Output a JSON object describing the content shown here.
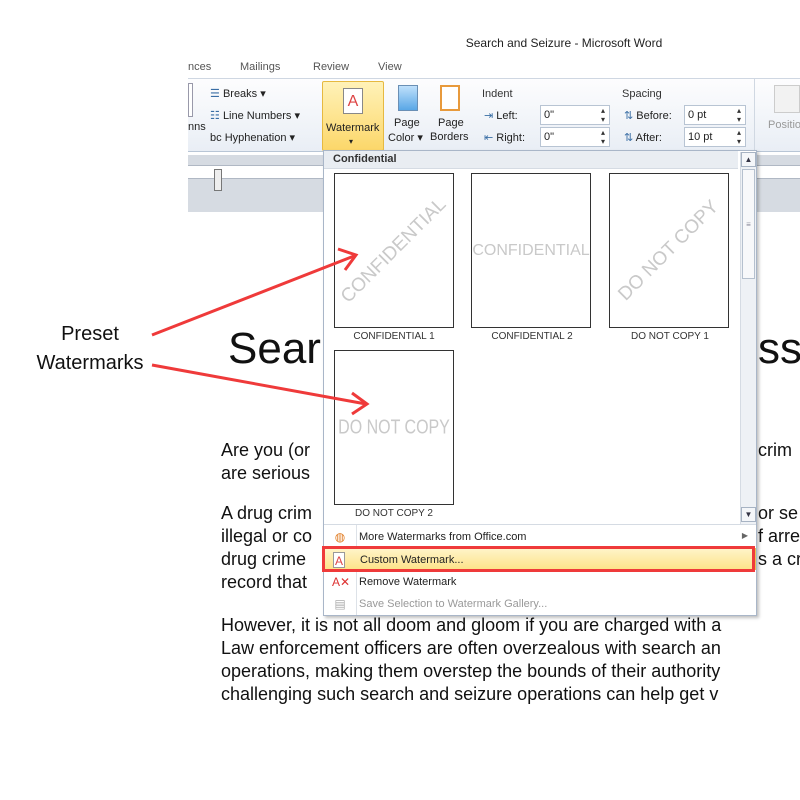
{
  "window": {
    "title": "Search and Seizure  -  Microsoft Word"
  },
  "tabs": [
    "nces",
    "Mailings",
    "Review",
    "View"
  ],
  "ribbon": {
    "page_setup": {
      "breaks": "Breaks",
      "line_numbers": "Line Numbers",
      "hyphenation": "Hyphenation",
      "columns_partial": "nns"
    },
    "watermark": "Watermark",
    "page_color": [
      "Page",
      "Color"
    ],
    "page_borders": [
      "Page",
      "Borders"
    ],
    "indent": {
      "label": "Indent",
      "left_label": "Left:",
      "left_value": "0\"",
      "right_label": "Right:",
      "right_value": "0\""
    },
    "spacing": {
      "label": "Spacing",
      "before_label": "Before:",
      "before_value": "0 pt",
      "after_label": "After:",
      "after_value": "10 pt"
    },
    "position": "Positio"
  },
  "gallery": {
    "header": "Confidential",
    "items": [
      {
        "label": "CONFIDENTIAL 1",
        "text": "CONFIDENTIAL",
        "style": "diagonal"
      },
      {
        "label": "CONFIDENTIAL 2",
        "text": "CONFIDENTIAL",
        "style": "horizontal"
      },
      {
        "label": "DO NOT COPY 1",
        "text": "DO NOT COPY",
        "style": "diagonal"
      },
      {
        "label": "DO NOT COPY 2",
        "text": "DO NOT COPY",
        "style": "horizontal"
      }
    ]
  },
  "menu": [
    {
      "label": "More Watermarks from Office.com",
      "icon": "office-globe-icon",
      "submenu": true
    },
    {
      "label": "Custom Watermark...",
      "icon": "watermark-icon",
      "highlighted": true
    },
    {
      "label": "Remove Watermark",
      "icon": "remove-watermark-icon"
    },
    {
      "label": "Save Selection to Watermark Gallery...",
      "icon": "save-gallery-icon",
      "disabled": true
    }
  ],
  "document": {
    "heading_left": "Sear",
    "heading_right": "ssu",
    "p1": [
      [
        "Are you (or",
        "crim"
      ],
      [
        "are serious",
        ""
      ]
    ],
    "p2": [
      [
        "A drug crim",
        "or se"
      ],
      [
        "illegal or co",
        "f arre"
      ],
      [
        "drug crime",
        "s a cr"
      ],
      [
        "record that",
        ""
      ]
    ],
    "p3": [
      "However, it is not all doom and gloom if you are charged with a",
      "Law enforcement officers are often overzealous with search an",
      "operations, making them overstep the bounds of their authority",
      "challenging such search and seizure operations can help get v"
    ]
  },
  "annotation": {
    "text": [
      "Preset",
      "Watermarks"
    ],
    "color": "#ef3a3a",
    "highlight_color": "#ef3a3a"
  }
}
